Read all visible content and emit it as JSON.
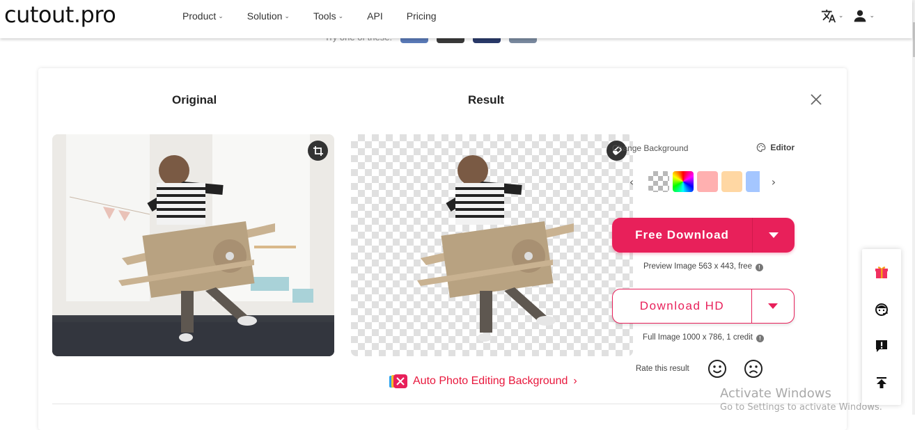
{
  "header": {
    "logo": "cutout.pro",
    "nav": [
      {
        "label": "Product",
        "has_dropdown": true
      },
      {
        "label": "Solution",
        "has_dropdown": true
      },
      {
        "label": "Tools",
        "has_dropdown": true
      },
      {
        "label": "API",
        "has_dropdown": false
      },
      {
        "label": "Pricing",
        "has_dropdown": false
      }
    ],
    "language_icon": "translate-icon",
    "account_icon": "user-icon"
  },
  "try_strip": {
    "label": "Try one of these:",
    "thumbs": [
      "#5a7ab8",
      "#3a3a3a",
      "#2a3a6a",
      "#7a8aa0"
    ]
  },
  "card": {
    "original_title": "Original",
    "result_title": "Result",
    "close_icon": "close-icon",
    "original_action_icon": "crop-icon",
    "result_action_icon": "eraser-icon",
    "auto_link": "Auto Photo Editing Background",
    "auto_link_chevron": "›"
  },
  "panel": {
    "change_background_label": "Change Background",
    "editor_label": "Editor",
    "swatches": [
      {
        "name": "transparent"
      },
      {
        "name": "rainbow"
      },
      {
        "name": "pink",
        "color": "#ffb0b0"
      },
      {
        "name": "peach",
        "color": "#ffd7a3"
      },
      {
        "name": "blue",
        "color": "#a4c6ff"
      }
    ],
    "free_download_label": "Free Download",
    "preview_note": "Preview Image 563 x 443, free",
    "download_hd_label": "Download HD",
    "full_note": "Full Image 1000 x 786, 1 credit",
    "rate_label": "Rate this result"
  },
  "sidebar": {
    "items": [
      "gift-icon",
      "support-icon",
      "feedback-icon",
      "back-to-top-icon"
    ]
  },
  "watermark": {
    "line1": "Activate Windows",
    "line2": "Go to Settings to activate Windows."
  },
  "colors": {
    "accent": "#e8205a",
    "link": "#e8173c"
  }
}
